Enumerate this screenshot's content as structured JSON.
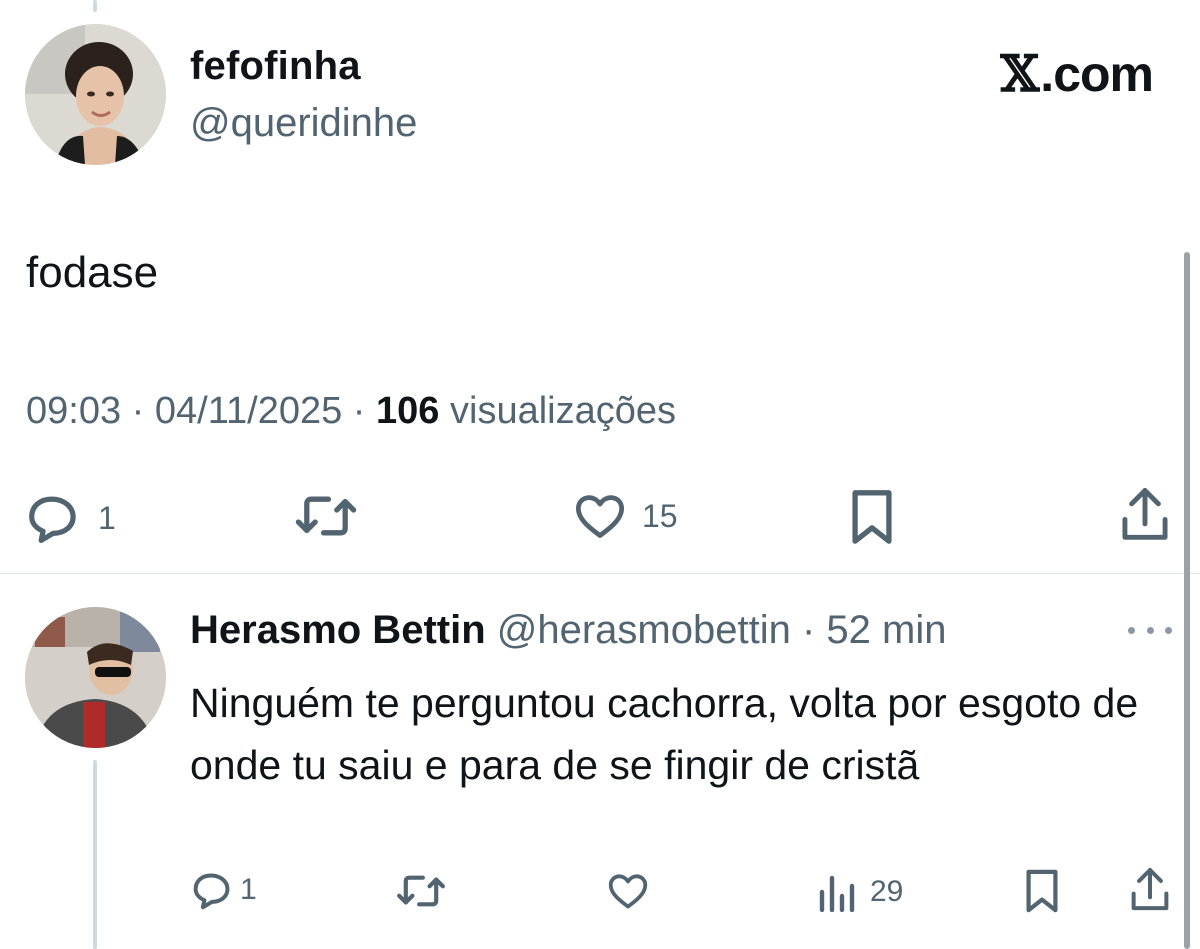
{
  "tweet": {
    "author_name": "fefofinha",
    "author_handle": "@queridinhe",
    "brand": {
      "x": "𝕏",
      "suffix": ".com"
    },
    "text": "fodase",
    "time": "09:03",
    "sep1": " · ",
    "date": "04/11/2025",
    "sep2": " · ",
    "views_count": "106",
    "views_label": " visualizações",
    "actions": {
      "reply_count": "1",
      "like_count": "15"
    }
  },
  "reply": {
    "author_name": "Herasmo Bettin",
    "author_handle": "@herasmobettin",
    "sep": " · ",
    "time": "52 min",
    "text": "Ninguém te perguntou cachorra, volta por esgoto de onde tu saiu e para de se fingir de cristã",
    "actions": {
      "reply_count": "1",
      "views_count": "29"
    }
  },
  "colors": {
    "text_primary": "#0f1419",
    "text_secondary": "#536471",
    "divider": "#dfe4e8",
    "thread_line": "#cfd9de"
  },
  "icons": [
    "reply-icon",
    "retweet-icon",
    "like-icon",
    "bookmark-icon",
    "share-icon",
    "views-icon",
    "more-icon"
  ]
}
